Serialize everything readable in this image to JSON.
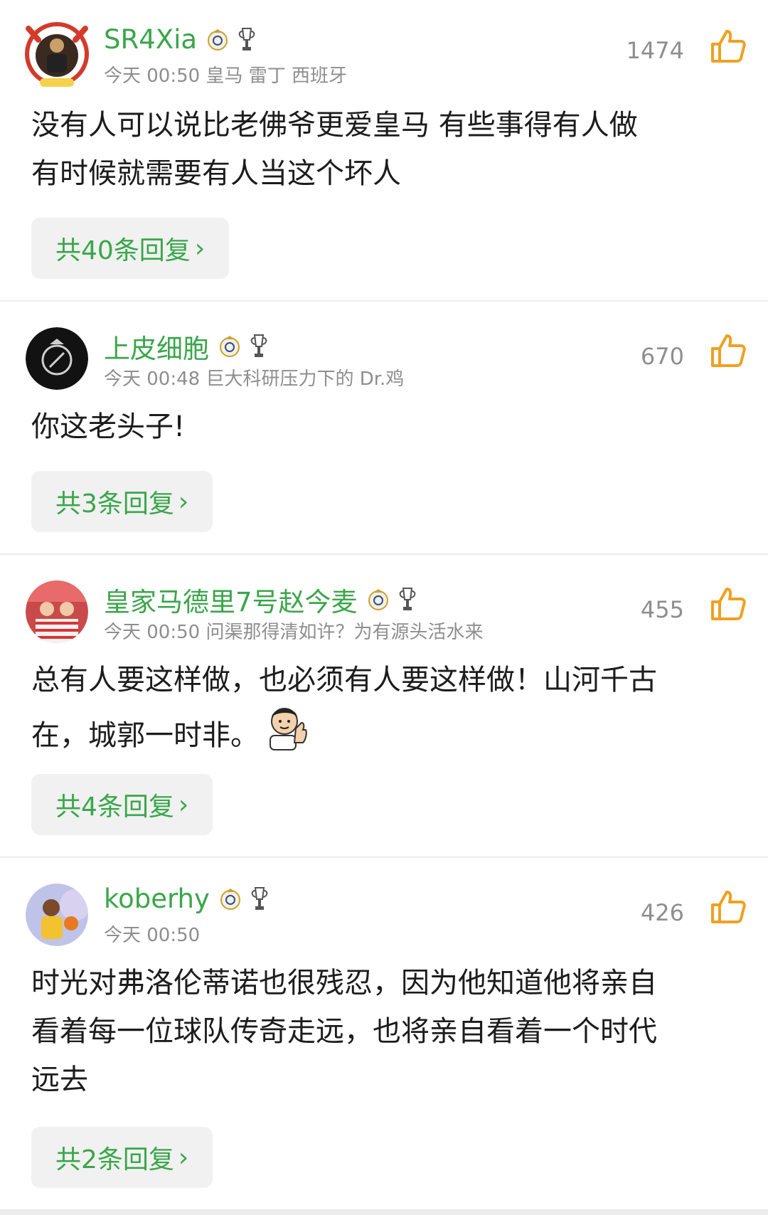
{
  "comments": [
    {
      "username": "SR4Xia",
      "meta": "今天 00:50 皇马 雷丁 西班牙",
      "likes": "1474",
      "lines": [
        "没有人可以说比老佛爷更爱皇马 有些事得有人做",
        "有时候就需要有人当这个坏人"
      ],
      "replies": "共40条回复"
    },
    {
      "username": "上皮细胞",
      "meta": "今天 00:48 巨大科研压力下的 Dr.鸡",
      "likes": "670",
      "lines": [
        "你这老头子!"
      ],
      "replies": "共3条回复"
    },
    {
      "username": "皇家马德里7号赵今麦",
      "meta": "今天 00:50 问渠那得清如许？为有源头活水来",
      "likes": "455",
      "lines": [
        "总有人要这样做，也必须有人要这样做！山河千古",
        "在，城郭一时非。"
      ],
      "replies": "共4条回复"
    },
    {
      "username": "koberhy",
      "meta": "今天 00:50",
      "likes": "426",
      "lines": [
        "时光对弗洛伦蒂诺也很残忍，因为他知道他将亲自",
        "看着每一位球队传奇走远，也将亲自看着一个时代",
        "远去"
      ],
      "replies": "共2条回复"
    }
  ],
  "colors": {
    "accent": "#3aa64a",
    "like": "#f0a020",
    "meta": "#8e8e8e"
  },
  "icons": {
    "like": "thumbs-up-icon",
    "badge1": "real-madrid-badge-icon",
    "badge2": "champions-trophy-icon",
    "chevron": "chevron-right-icon"
  },
  "chevron": "›"
}
